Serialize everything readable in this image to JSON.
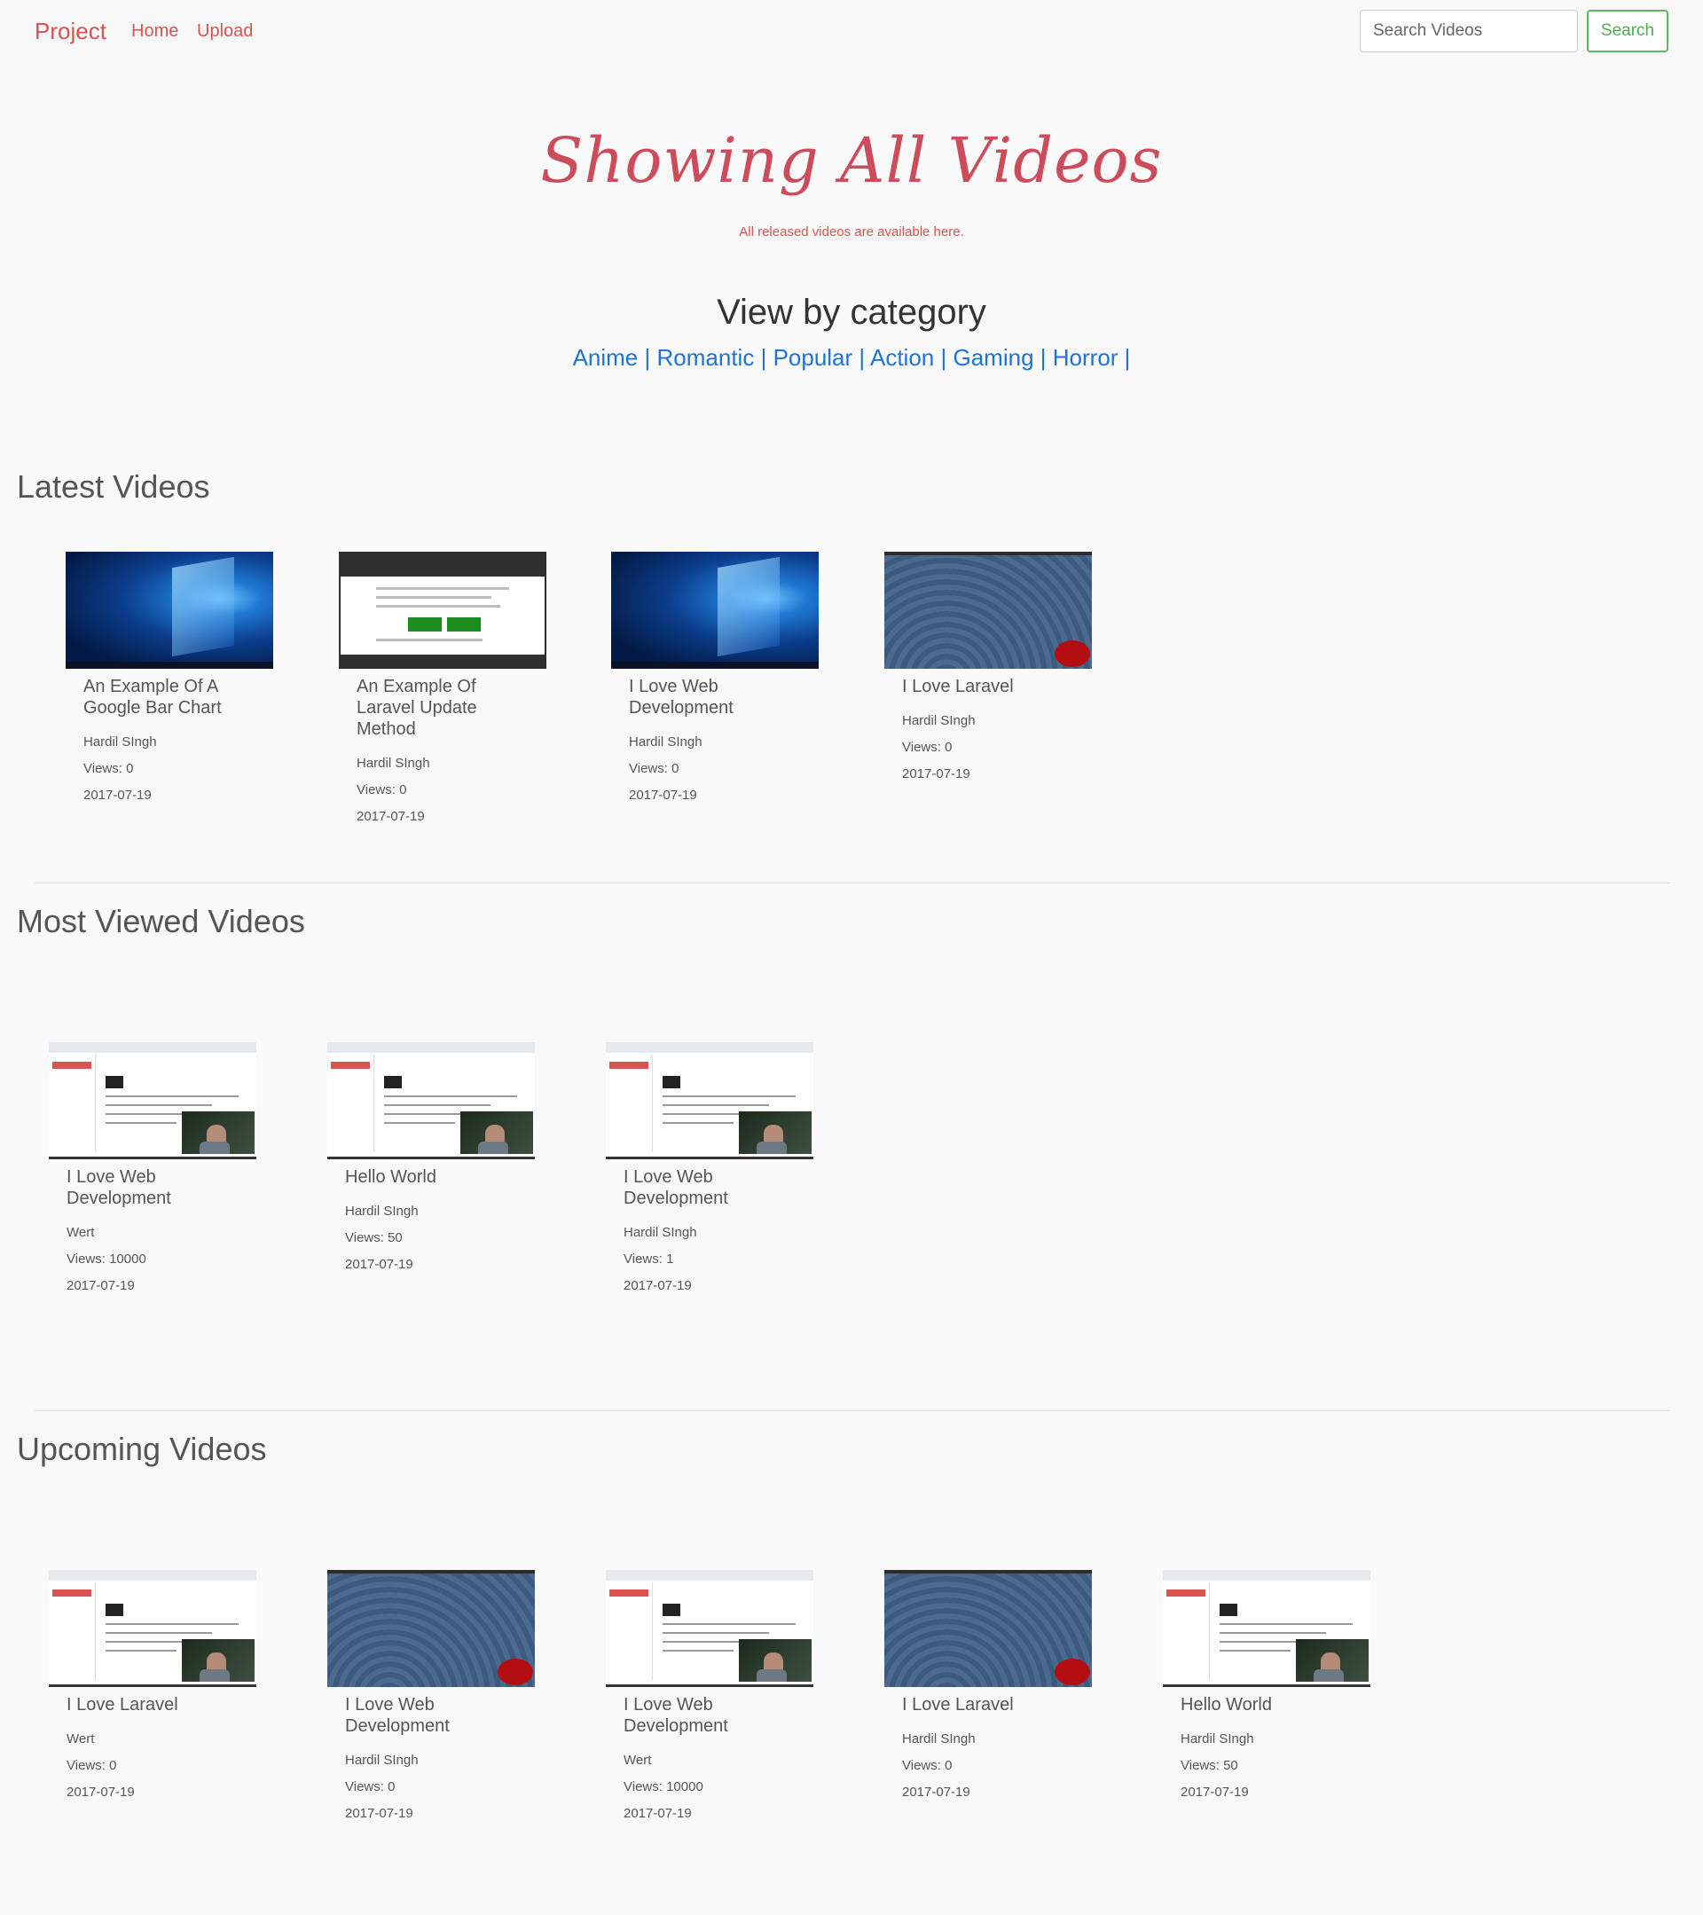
{
  "nav": {
    "brand": "Project",
    "links": [
      "Home",
      "Upload"
    ],
    "search_placeholder": "Search Videos",
    "search_button": "Search"
  },
  "hero": {
    "title": "Showing All Videos",
    "subtitle": "All released videos are available here."
  },
  "categories": {
    "title": "View by category",
    "items": [
      "Anime",
      "Romantic",
      "Popular",
      "Action",
      "Gaming",
      "Horror"
    ],
    "separator": "|"
  },
  "sections": {
    "latest": {
      "title": "Latest Videos",
      "videos": [
        {
          "title": "An Example Of A Google Bar Chart",
          "author": "Hardil SIngh",
          "views": "Views: 0",
          "date": "2017-07-19",
          "thumb": "windows-desktop"
        },
        {
          "title": "An Example Of Laravel Update Method",
          "author": "Hardil SIngh",
          "views": "Views: 0",
          "date": "2017-07-19",
          "thumb": "node-website"
        },
        {
          "title": "I Love Web Development",
          "author": "Hardil SIngh",
          "views": "Views: 0",
          "date": "2017-07-19",
          "thumb": "windows-desktop"
        },
        {
          "title": "I Love Laravel",
          "author": "Hardil SIngh",
          "views": "Views: 0",
          "date": "2017-07-19",
          "thumb": "pattern-wallpaper"
        }
      ]
    },
    "most_viewed": {
      "title": "Most Viewed Videos",
      "videos": [
        {
          "title": "I Love Web Development",
          "author": "Wert",
          "views": "Views: 10000",
          "date": "2017-07-19",
          "thumb": "ide-webcam"
        },
        {
          "title": "Hello World",
          "author": "Hardil SIngh",
          "views": "Views: 50",
          "date": "2017-07-19",
          "thumb": "ide-webcam"
        },
        {
          "title": "I Love Web Development",
          "author": "Hardil SIngh",
          "views": "Views: 1",
          "date": "2017-07-19",
          "thumb": "ide-webcam"
        }
      ]
    },
    "upcoming": {
      "title": "Upcoming Videos",
      "videos": [
        {
          "title": "I Love Laravel",
          "author": "Wert",
          "views": "Views: 0",
          "date": "2017-07-19",
          "thumb": "ide-webcam"
        },
        {
          "title": "I Love Web Development",
          "author": "Hardil SIngh",
          "views": "Views: 0",
          "date": "2017-07-19",
          "thumb": "pattern-wallpaper"
        },
        {
          "title": "I Love Web Development",
          "author": "Wert",
          "views": "Views: 10000",
          "date": "2017-07-19",
          "thumb": "ide-webcam"
        },
        {
          "title": "I Love Laravel",
          "author": "Hardil SIngh",
          "views": "Views: 0",
          "date": "2017-07-19",
          "thumb": "pattern-wallpaper"
        },
        {
          "title": "Hello World",
          "author": "Hardil SIngh",
          "views": "Views: 50",
          "date": "2017-07-19",
          "thumb": "ide-webcam"
        }
      ]
    }
  },
  "colors": {
    "accent": "#d9534f",
    "link": "#1e73d8",
    "success": "#5cb85c",
    "background": "#f9f9f9"
  }
}
